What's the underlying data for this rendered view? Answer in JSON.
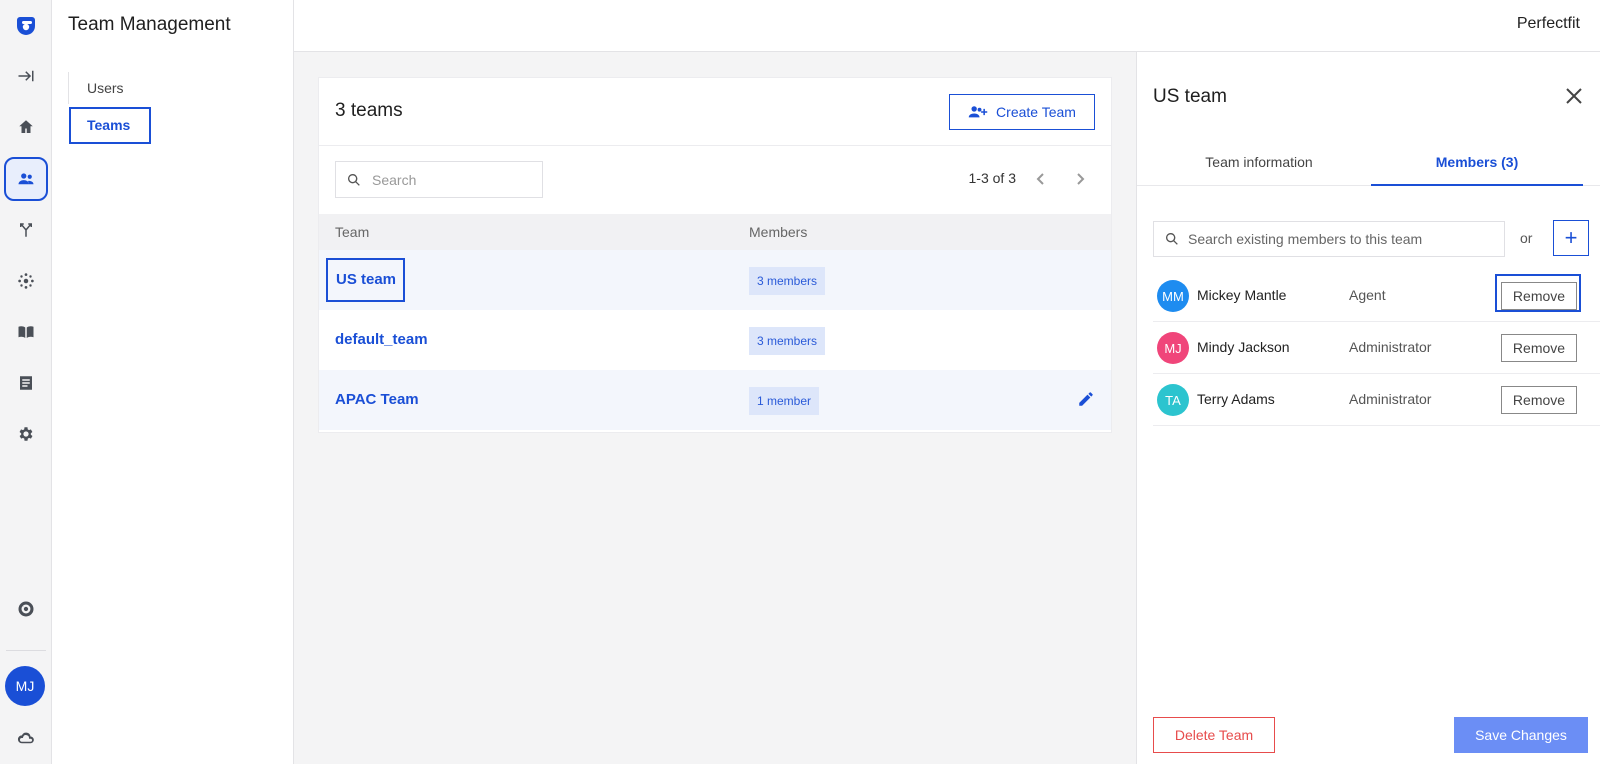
{
  "app": {
    "brand": "Perfectfit"
  },
  "rail": {
    "icons": [
      "logo-icon",
      "expand-icon",
      "home-icon",
      "team-icon",
      "routing-icon",
      "integrations-icon",
      "knowledge-icon",
      "reports-icon",
      "settings-icon",
      "help-icon",
      "cloud-icon"
    ],
    "avatar_initials": "MJ",
    "active": "team-icon"
  },
  "subnav": {
    "title": "Team Management",
    "items": [
      {
        "label": "Users"
      },
      {
        "label": "Teams"
      }
    ]
  },
  "teams_card": {
    "title": "3 teams",
    "create_button": "Create Team",
    "search_placeholder": "Search",
    "pagination": "1-3 of 3",
    "columns": [
      "Team",
      "Members"
    ],
    "rows": [
      {
        "name": "US team",
        "members": "3 members"
      },
      {
        "name": "default_team",
        "members": "3 members"
      },
      {
        "name": "APAC Team",
        "members": "1 member"
      }
    ]
  },
  "panel": {
    "title": "US team",
    "tabs": [
      {
        "label": "Team information"
      },
      {
        "label": "Members (3)"
      }
    ],
    "member_search_placeholder": "Search existing members to this team",
    "or_text": "or",
    "add_label": "+",
    "members": [
      {
        "initials": "MM",
        "name": "Mickey Mantle",
        "role": "Agent",
        "color": "#1e8cf0",
        "action": "Remove"
      },
      {
        "initials": "MJ",
        "name": "Mindy Jackson",
        "role": "Administrator",
        "color": "#f0457a",
        "action": "Remove"
      },
      {
        "initials": "TA",
        "name": "Terry Adams",
        "role": "Administrator",
        "color": "#2cc4cf",
        "action": "Remove"
      }
    ],
    "delete_button": "Delete Team",
    "save_button": "Save Changes"
  },
  "colors": {
    "accent": "#1a4fd6",
    "danger": "#e74c4c",
    "save": "#6b8ef5"
  }
}
